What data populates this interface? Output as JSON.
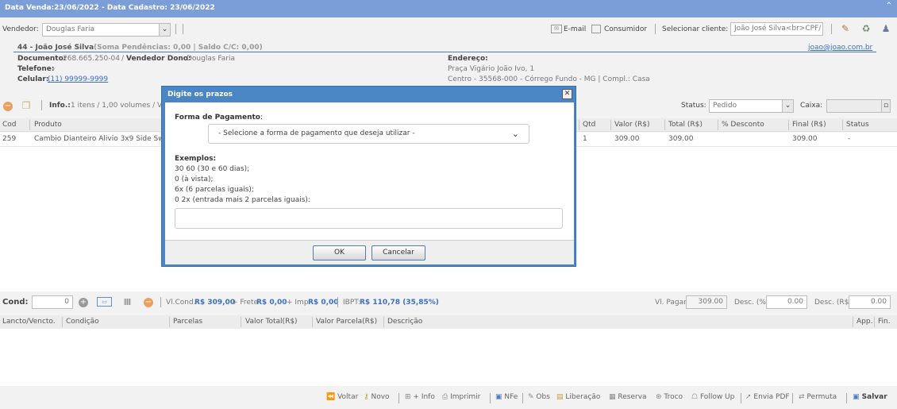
{
  "header": {
    "title": "Data Venda:23/06/2022 - Data Cadastro: 23/06/2022",
    "collapse_icon": "double-chevron-up-icon"
  },
  "seller": {
    "label": "Vendedor:",
    "value": "Douglas Faria"
  },
  "top_actions": {
    "email_label": "E-mail",
    "consumer_label": "Consumidor",
    "select_client_label": "Selecionar cliente:",
    "select_client_value": "João José Silva<br>CPF/"
  },
  "customer": {
    "code_name": "44 - João José Silva",
    "summary": "(Soma Pendências: 0,00 | Saldo C/C: 0,00)",
    "email": "joao@joao.com.br",
    "document_label": "Documento:",
    "document_value": "268.665.250-04",
    "owner_seller_label": "Vendedor Dono:",
    "owner_seller_value": "Douglas Faria",
    "phone_label": "Telefone:",
    "phone_value": "-",
    "mobile_label": "Celular:",
    "mobile_value": "(11) 99999-9999",
    "address_label": "Endereço:",
    "address_line1": "Praça Vigário João Ivo, 1",
    "address_line2": "Centro - 35568-000 - Córrego Fundo - MG | Compl.: Casa"
  },
  "infobar": {
    "info_label": "Info.:",
    "info_value": "1 itens / 1,00 volumes / Va",
    "status_label": "Status:",
    "status_value": "Pedido",
    "cashier_label": "Caixa:"
  },
  "items_grid": {
    "columns": [
      "Cod",
      "Produto",
      "Qtd",
      "Valor (R$)",
      "Total (R$)",
      "% Desconto",
      "Final (R$)",
      "Status"
    ],
    "rows": [
      {
        "cod": "259",
        "produto": "Cambio Dianteiro Alivio 3x9 Side Sw",
        "qtd": "1",
        "valor": "309.00",
        "total": "309.00",
        "desconto": "",
        "final": "309.00",
        "status": "-"
      }
    ]
  },
  "cond_bar": {
    "label": "Cond:",
    "value": "0",
    "vlcond_label": "Vl.Cond.",
    "vlcond_value": "R$ 309,00",
    "frete_label": "+ Frete",
    "frete_value": "R$ 0,00",
    "imp_label": "+ Imp.",
    "imp_value": "R$ 0,00",
    "ibpt_label": "IBPT:",
    "ibpt_value": "R$ 110,78 (35,85%)",
    "vl_pagar_label": "Vl. Pagar:",
    "vl_pagar_value": "309.00",
    "desc_pct_label": "Desc. (%):",
    "desc_pct_value": "0.00",
    "desc_rs_label": "Desc. (R$):",
    "desc_rs_value": "0.00"
  },
  "pay_grid": {
    "columns": [
      "Lancto/Vencto.",
      "Condição",
      "Parcelas",
      "Valor Total(R$)",
      "Valor Parcela(R$)",
      "Descrição",
      "App.",
      "Fin."
    ]
  },
  "footer": {
    "voltar": "Voltar",
    "novo": "Novo",
    "info": "+ Info",
    "imprimir": "Imprimir",
    "nfe": "NFe",
    "obs": "Obs",
    "liberacao": "Liberação",
    "reserva": "Reserva",
    "troco": "Troco",
    "follow_up": "Follow Up",
    "envia_pdf": "Envia PDF",
    "permuta": "Permuta",
    "salvar": "Salvar"
  },
  "dialog": {
    "title": "Digite os prazos",
    "payment_label": "Forma de Pagamento",
    "payment_colon": ":",
    "payment_placeholder": "- Selecione a forma de pagamento que deseja utilizar -",
    "examples_label": "Exemplos:",
    "example1": "30 60 (30 e 60 dias);",
    "example2": "0 (à vista);",
    "example3": "6x (6 parcelas iguais);",
    "example4": "0 2x (entrada mais 2 parcelas iguais):",
    "input_value": "",
    "ok_label": "OK",
    "cancel_label": "Cancelar"
  }
}
